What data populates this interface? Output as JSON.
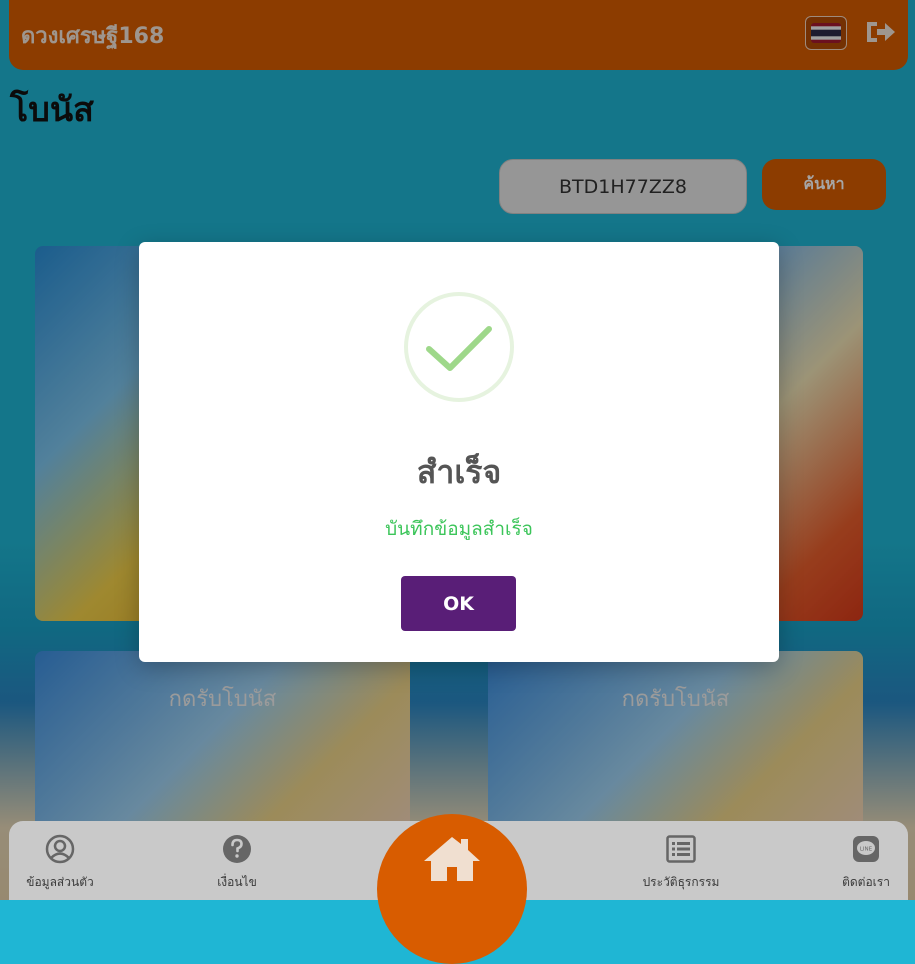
{
  "header": {
    "brand": "ดวงเศรษฐี168"
  },
  "page": {
    "title": "โบนัส"
  },
  "search": {
    "value": "BTD1H77ZZ8",
    "button_label": "ค้นหา"
  },
  "promos": [
    {
      "label": ""
    },
    {
      "label": ""
    },
    {
      "label": "กดรับโบนัส"
    },
    {
      "label": "กดรับโบนัส"
    }
  ],
  "modal": {
    "title": "สำเร็จ",
    "message": "บันทึกข้อมูลสำเร็จ",
    "ok_label": "OK",
    "icon": "success-check-icon"
  },
  "bottom_nav": {
    "items": [
      {
        "label": "ข้อมูลส่วนตัว",
        "icon": "user-circle-icon"
      },
      {
        "label": "เงื่อนไข",
        "icon": "question-circle-icon"
      },
      {
        "label": "ประวัติธุรกรรม",
        "icon": "list-icon"
      },
      {
        "label": "ติดต่อเรา",
        "icon": "line-chat-icon"
      }
    ],
    "home_icon": "home-icon"
  },
  "colors": {
    "brand": "#d85c00",
    "ok_button": "#591e77",
    "success_green": "#3cc55a",
    "background": "#1fb6d4"
  }
}
